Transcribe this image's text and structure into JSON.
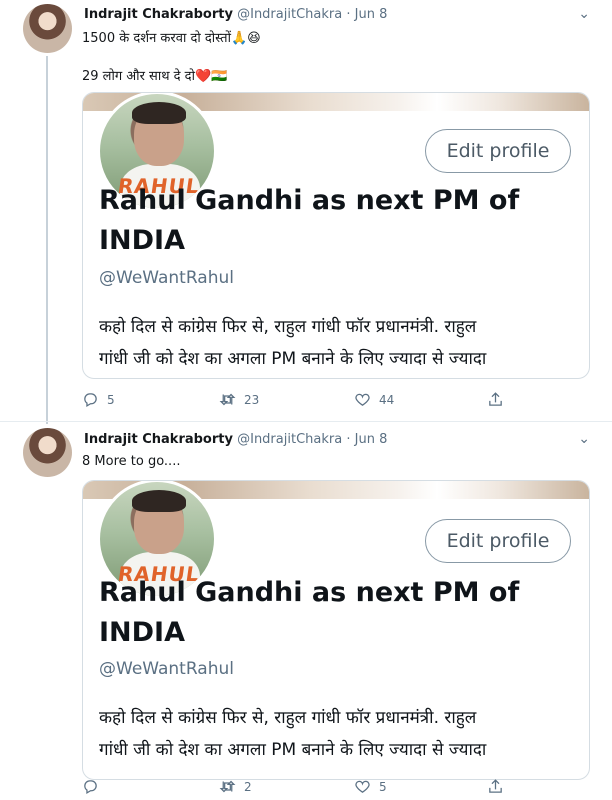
{
  "tweets": [
    {
      "name": "Indrajit Chakraborty",
      "handle": "@IndrajitChakra",
      "separator": "·",
      "date": "Jun 8",
      "lines": [
        "1500 के दर्शन करवा दो दोस्तों🙏😆",
        "29 लोग और साथ दे दो❤️🇮🇳"
      ],
      "card": {
        "title_line1": "Rahul Gandhi as next PM of",
        "title_line2": "INDIA",
        "handle": "@WeWantRahul",
        "button": "Edit profile",
        "bio_line1": "कहो दिल से कांग्रेस फिर से, राहुल गांधी फॉर प्रधानमंत्री. राहुल",
        "bio_line2": "गांधी जी को देश का अगला PM बनाने के लिए ज्यादा से ज्यादा",
        "logo_text": "RAHUL"
      },
      "actions": {
        "replies": "5",
        "retweets": "23",
        "likes": "44"
      }
    },
    {
      "name": "Indrajit Chakraborty",
      "handle": "@IndrajitChakra",
      "separator": "·",
      "date": "Jun 8",
      "lines": [
        "8 More to go...."
      ],
      "card": {
        "title_line1": "Rahul Gandhi as next PM of",
        "title_line2": "INDIA",
        "handle": "@WeWantRahul",
        "button": "Edit profile",
        "bio_line1": "कहो दिल से कांग्रेस फिर से, राहुल गांधी फॉर प्रधानमंत्री. राहुल",
        "bio_line2": "गांधी जी को देश का अगला PM बनाने के लिए ज्यादा से ज्यादा",
        "logo_text": "RAHUL"
      },
      "actions": {
        "replies": "",
        "retweets": "2",
        "likes": "5"
      }
    }
  ],
  "icons": {
    "more": "chevron-down-icon",
    "reply": "reply-icon",
    "retweet": "retweet-icon",
    "like": "heart-icon",
    "share": "share-icon"
  },
  "colors": {
    "text": "#14171a",
    "secondary": "#5b7083",
    "border": "#d5dde3",
    "thread": "#c7d1d9"
  }
}
